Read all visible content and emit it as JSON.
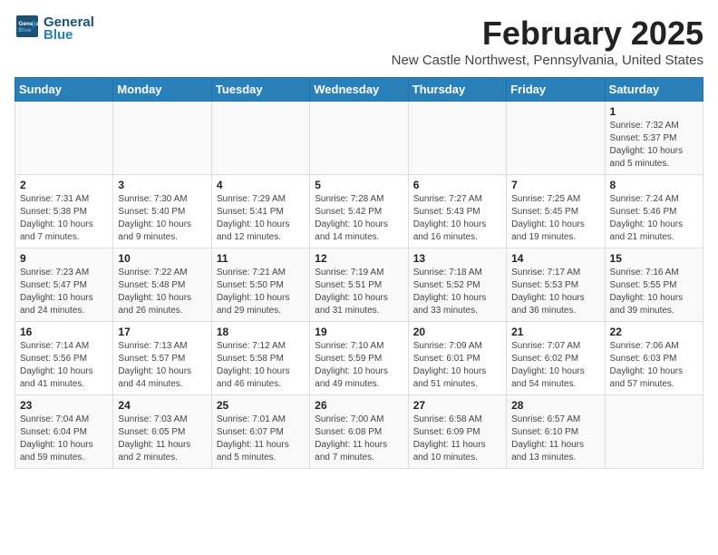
{
  "header": {
    "logo_line1": "General",
    "logo_line2": "Blue",
    "month_year": "February 2025",
    "location": "New Castle Northwest, Pennsylvania, United States"
  },
  "days_of_week": [
    "Sunday",
    "Monday",
    "Tuesday",
    "Wednesday",
    "Thursday",
    "Friday",
    "Saturday"
  ],
  "weeks": [
    [
      {
        "day": "",
        "info": ""
      },
      {
        "day": "",
        "info": ""
      },
      {
        "day": "",
        "info": ""
      },
      {
        "day": "",
        "info": ""
      },
      {
        "day": "",
        "info": ""
      },
      {
        "day": "",
        "info": ""
      },
      {
        "day": "1",
        "info": "Sunrise: 7:32 AM\nSunset: 5:37 PM\nDaylight: 10 hours\nand 5 minutes."
      }
    ],
    [
      {
        "day": "2",
        "info": "Sunrise: 7:31 AM\nSunset: 5:38 PM\nDaylight: 10 hours\nand 7 minutes."
      },
      {
        "day": "3",
        "info": "Sunrise: 7:30 AM\nSunset: 5:40 PM\nDaylight: 10 hours\nand 9 minutes."
      },
      {
        "day": "4",
        "info": "Sunrise: 7:29 AM\nSunset: 5:41 PM\nDaylight: 10 hours\nand 12 minutes."
      },
      {
        "day": "5",
        "info": "Sunrise: 7:28 AM\nSunset: 5:42 PM\nDaylight: 10 hours\nand 14 minutes."
      },
      {
        "day": "6",
        "info": "Sunrise: 7:27 AM\nSunset: 5:43 PM\nDaylight: 10 hours\nand 16 minutes."
      },
      {
        "day": "7",
        "info": "Sunrise: 7:25 AM\nSunset: 5:45 PM\nDaylight: 10 hours\nand 19 minutes."
      },
      {
        "day": "8",
        "info": "Sunrise: 7:24 AM\nSunset: 5:46 PM\nDaylight: 10 hours\nand 21 minutes."
      }
    ],
    [
      {
        "day": "9",
        "info": "Sunrise: 7:23 AM\nSunset: 5:47 PM\nDaylight: 10 hours\nand 24 minutes."
      },
      {
        "day": "10",
        "info": "Sunrise: 7:22 AM\nSunset: 5:48 PM\nDaylight: 10 hours\nand 26 minutes."
      },
      {
        "day": "11",
        "info": "Sunrise: 7:21 AM\nSunset: 5:50 PM\nDaylight: 10 hours\nand 29 minutes."
      },
      {
        "day": "12",
        "info": "Sunrise: 7:19 AM\nSunset: 5:51 PM\nDaylight: 10 hours\nand 31 minutes."
      },
      {
        "day": "13",
        "info": "Sunrise: 7:18 AM\nSunset: 5:52 PM\nDaylight: 10 hours\nand 33 minutes."
      },
      {
        "day": "14",
        "info": "Sunrise: 7:17 AM\nSunset: 5:53 PM\nDaylight: 10 hours\nand 36 minutes."
      },
      {
        "day": "15",
        "info": "Sunrise: 7:16 AM\nSunset: 5:55 PM\nDaylight: 10 hours\nand 39 minutes."
      }
    ],
    [
      {
        "day": "16",
        "info": "Sunrise: 7:14 AM\nSunset: 5:56 PM\nDaylight: 10 hours\nand 41 minutes."
      },
      {
        "day": "17",
        "info": "Sunrise: 7:13 AM\nSunset: 5:57 PM\nDaylight: 10 hours\nand 44 minutes."
      },
      {
        "day": "18",
        "info": "Sunrise: 7:12 AM\nSunset: 5:58 PM\nDaylight: 10 hours\nand 46 minutes."
      },
      {
        "day": "19",
        "info": "Sunrise: 7:10 AM\nSunset: 5:59 PM\nDaylight: 10 hours\nand 49 minutes."
      },
      {
        "day": "20",
        "info": "Sunrise: 7:09 AM\nSunset: 6:01 PM\nDaylight: 10 hours\nand 51 minutes."
      },
      {
        "day": "21",
        "info": "Sunrise: 7:07 AM\nSunset: 6:02 PM\nDaylight: 10 hours\nand 54 minutes."
      },
      {
        "day": "22",
        "info": "Sunrise: 7:06 AM\nSunset: 6:03 PM\nDaylight: 10 hours\nand 57 minutes."
      }
    ],
    [
      {
        "day": "23",
        "info": "Sunrise: 7:04 AM\nSunset: 6:04 PM\nDaylight: 10 hours\nand 59 minutes."
      },
      {
        "day": "24",
        "info": "Sunrise: 7:03 AM\nSunset: 6:05 PM\nDaylight: 11 hours\nand 2 minutes."
      },
      {
        "day": "25",
        "info": "Sunrise: 7:01 AM\nSunset: 6:07 PM\nDaylight: 11 hours\nand 5 minutes."
      },
      {
        "day": "26",
        "info": "Sunrise: 7:00 AM\nSunset: 6:08 PM\nDaylight: 11 hours\nand 7 minutes."
      },
      {
        "day": "27",
        "info": "Sunrise: 6:58 AM\nSunset: 6:09 PM\nDaylight: 11 hours\nand 10 minutes."
      },
      {
        "day": "28",
        "info": "Sunrise: 6:57 AM\nSunset: 6:10 PM\nDaylight: 11 hours\nand 13 minutes."
      },
      {
        "day": "",
        "info": ""
      }
    ]
  ]
}
